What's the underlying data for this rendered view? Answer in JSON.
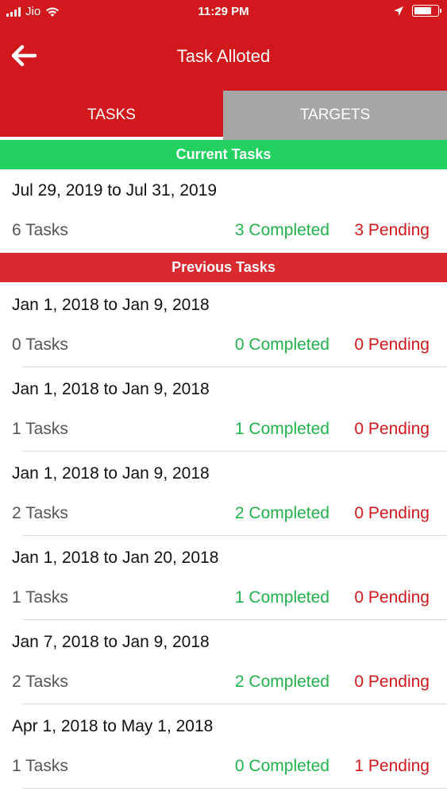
{
  "status_bar": {
    "carrier": "Jio",
    "time": "11:29 PM",
    "battery_level": 0.75
  },
  "nav": {
    "title": "Task Alloted",
    "back_icon": "back-arrow-icon"
  },
  "tabs": [
    {
      "label": "TASKS",
      "active": true
    },
    {
      "label": "TARGETS",
      "active": false
    }
  ],
  "colors": {
    "header_red": "#d0181d",
    "current_green": "#22d160",
    "previous_red": "#d92a2f",
    "completed_green": "#22b14c",
    "pending_red": "#d0181d",
    "inactive_tab_gray": "#a6a6a6"
  },
  "current_section": {
    "title": "Current Tasks",
    "items": [
      {
        "date_range": "Jul 29, 2019 to Jul 31, 2019",
        "tasks": "6 Tasks",
        "completed": "3 Completed",
        "pending": "3 Pending"
      }
    ]
  },
  "previous_section": {
    "title": "Previous Tasks",
    "items": [
      {
        "date_range": "Jan 1, 2018 to Jan 9, 2018",
        "tasks": "0 Tasks",
        "completed": "0 Completed",
        "pending": "0 Pending"
      },
      {
        "date_range": "Jan 1, 2018 to Jan 9, 2018",
        "tasks": "1 Tasks",
        "completed": "1 Completed",
        "pending": "0 Pending"
      },
      {
        "date_range": "Jan 1, 2018 to Jan 9, 2018",
        "tasks": "2 Tasks",
        "completed": "2 Completed",
        "pending": "0 Pending"
      },
      {
        "date_range": "Jan 1, 2018 to Jan 20, 2018",
        "tasks": "1 Tasks",
        "completed": "1 Completed",
        "pending": "0 Pending"
      },
      {
        "date_range": "Jan 7, 2018 to Jan 9, 2018",
        "tasks": "2 Tasks",
        "completed": "2 Completed",
        "pending": "0 Pending"
      },
      {
        "date_range": "Apr 1, 2018 to May 1, 2018",
        "tasks": "1 Tasks",
        "completed": "0 Completed",
        "pending": "1 Pending"
      }
    ]
  }
}
